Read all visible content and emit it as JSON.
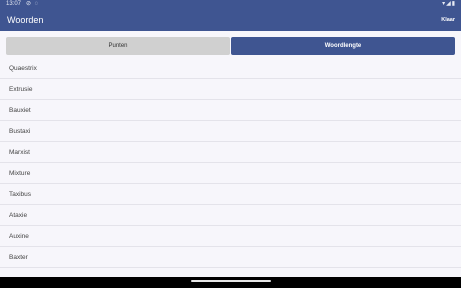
{
  "status": {
    "time": "13:07",
    "left_icons": "⊘ ◌",
    "right_icons": "▾◢▮"
  },
  "appbar": {
    "title": "Woorden",
    "close_label": "Klaar"
  },
  "tabs": [
    {
      "label": "Punten",
      "active": false
    },
    {
      "label": "Woordlengte",
      "active": true
    }
  ],
  "words": [
    "Quaestrix",
    "Extrusie",
    "Bauxiet",
    "Bustaxi",
    "Marxist",
    "Mixture",
    "Taxibus",
    "Ataxie",
    "Auxine",
    "Baxter"
  ],
  "colors": {
    "accent": "#3f5591",
    "background": "#f7f6fb",
    "inactive_tab": "#d0d0d0"
  },
  "icons": [
    "wifi-icon",
    "signal-icon",
    "battery-icon",
    "gesture-pill"
  ]
}
